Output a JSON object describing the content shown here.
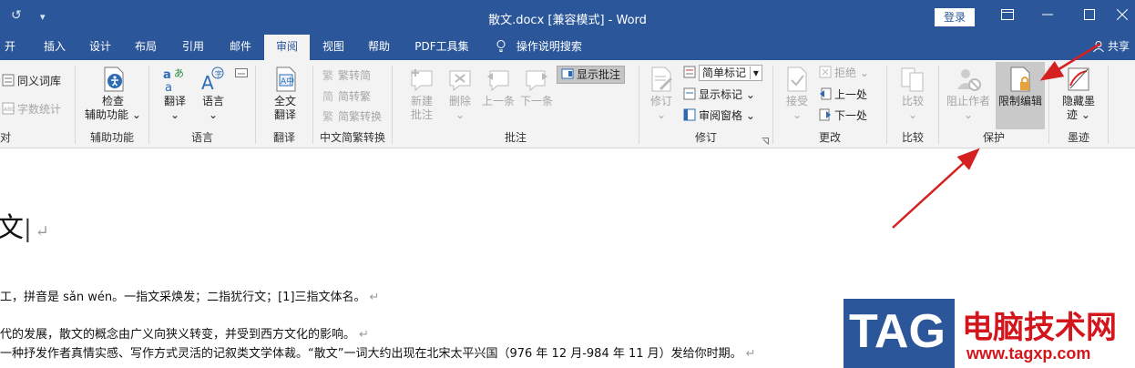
{
  "window": {
    "title": "散文.docx [兼容模式] - Word",
    "login_label": "登录",
    "restore_icon": "ribbon-display-icon",
    "minimize_icon": "minimize-icon",
    "maximize_icon": "maximize-icon",
    "close_icon": "close-icon",
    "undo_glyph": "↺",
    "customize_glyph": "▾"
  },
  "tabs": {
    "items": [
      "开始",
      "插入",
      "设计",
      "布局",
      "引用",
      "邮件",
      "审阅",
      "视图",
      "帮助",
      "PDF工具集",
      "操作说明搜索"
    ],
    "active": "审阅",
    "share_label": "共享"
  },
  "ribbon": {
    "proofing": {
      "thesaurus": "同义词库",
      "wordcount": "字数统计",
      "label": "对"
    },
    "accessibility": {
      "check": "检查",
      "check2": "辅助功能",
      "label": "辅助功能"
    },
    "language": {
      "translate": "翻译",
      "language": "语言",
      "label": "语言"
    },
    "translation": {
      "fulltext": "全文",
      "fulltext2": "翻译",
      "label": "翻译"
    },
    "chinese": {
      "to_trad": "繁转简",
      "to_simp": "简转繁",
      "convert": "简繁转换",
      "label": "中文简繁转换"
    },
    "comments": {
      "new": "新建",
      "new2": "批注",
      "delete": "删除",
      "prev": "上一条",
      "next": "下一条",
      "show": "显示批注",
      "label": "批注"
    },
    "tracking": {
      "track": "修订",
      "markup_select": "简单标记",
      "show_markup": "显示标记",
      "review_pane": "审阅窗格",
      "label": "修订"
    },
    "changes": {
      "accept": "接受",
      "reject": "拒绝",
      "prev": "上一处",
      "next": "下一处",
      "label": "更改"
    },
    "compare": {
      "compare": "比较",
      "label": "比较"
    },
    "protect": {
      "block": "阻止作者",
      "restrict": "限制编辑",
      "label": "保护"
    },
    "ink": {
      "hide": "隐藏墨",
      "hide2": "迹",
      "label": "墨迹"
    }
  },
  "document": {
    "heading": "文",
    "lines": [
      "工，拼音是 sǎn wén。一指文采焕发；二指犹行文；[1]三指文体名。",
      "代的发展，散文的概念由广义向狭义转变，并受到西方文化的影响。",
      "一种抒发作者真情实感、写作方式灵活的记叙类文学体裁。“散文”一词大约出现在北宋太平兴国（976 年 12 月-984 年 11 月）发给你时期。"
    ]
  },
  "watermark": {
    "logo": "TAG",
    "title": "电脑技术网",
    "url": "www.tagxp.com"
  },
  "colors": {
    "brand": "#2b579a",
    "arrow": "#d42020",
    "watermark": "#d2161c"
  }
}
